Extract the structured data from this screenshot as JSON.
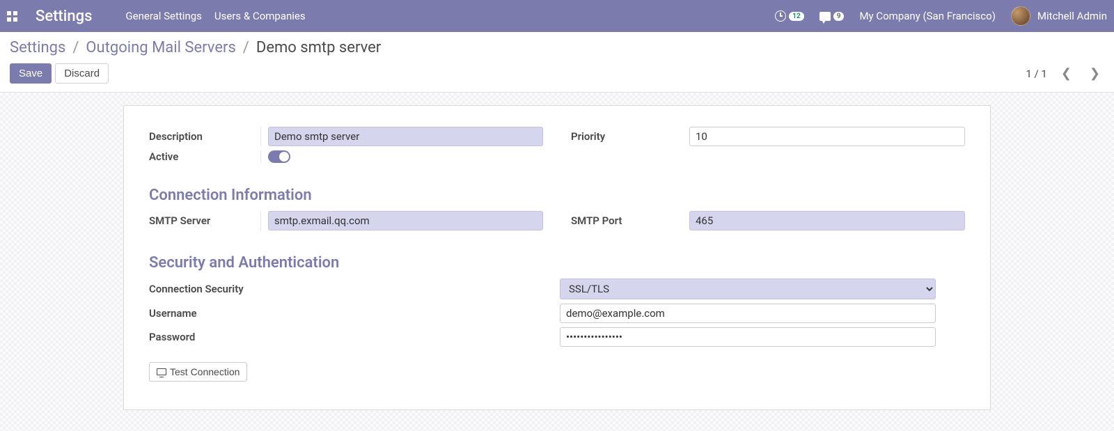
{
  "navbar": {
    "app_title": "Settings",
    "links": [
      "General Settings",
      "Users & Companies"
    ],
    "activity_count": "12",
    "messages_count": "9",
    "company": "My Company (San Francisco)",
    "user": "Mitchell Admin"
  },
  "breadcrumb": {
    "root": "Settings",
    "parent": "Outgoing Mail Servers",
    "current": "Demo smtp server"
  },
  "actions": {
    "save": "Save",
    "discard": "Discard",
    "pager": "1 / 1"
  },
  "form": {
    "labels": {
      "description": "Description",
      "active": "Active",
      "priority": "Priority",
      "connection_info": "Connection Information",
      "smtp_server": "SMTP Server",
      "smtp_port": "SMTP Port",
      "security_auth": "Security and Authentication",
      "connection_security": "Connection Security",
      "username": "Username",
      "password": "Password",
      "test_connection": "Test Connection"
    },
    "values": {
      "description": "Demo smtp server",
      "active": true,
      "priority": "10",
      "smtp_server": "smtp.exmail.qq.com",
      "smtp_port": "465",
      "connection_security": "SSL/TLS",
      "username": "demo@example.com",
      "password": "••••••••••••••••"
    }
  }
}
